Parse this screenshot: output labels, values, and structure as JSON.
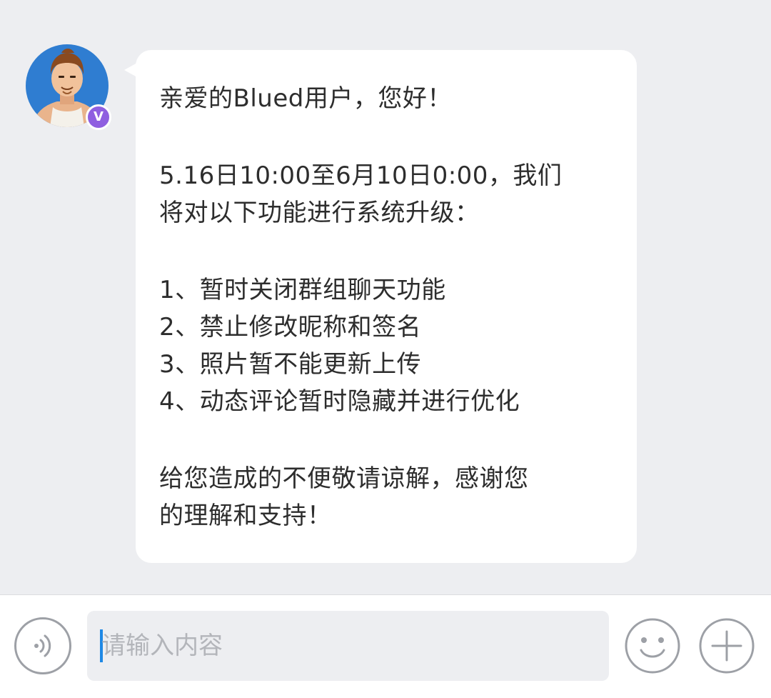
{
  "chat": {
    "sender": {
      "avatar_icon": "user-avatar-icon",
      "verified_badge": "V"
    },
    "message_lines": [
      "亲爱的Blued用户，您好！",
      "5.16日10:00至6月10日0:00，我们",
      "将对以下功能进行系统升级：",
      "1、暂时关闭群组聊天功能",
      "2、禁止修改昵称和签名",
      "3、照片暂不能更新上传",
      "4、动态评论暂时隐藏并进行优化",
      "给您造成的不便敬请谅解，感谢您",
      "的理解和支持！"
    ]
  },
  "input_bar": {
    "voice_icon": "voice-icon",
    "placeholder": "请输入内容",
    "emoji_icon": "smiley-icon",
    "add_icon": "plus-icon"
  },
  "colors": {
    "background": "#edeef1",
    "bubble": "#ffffff",
    "text": "#2d2d2d",
    "icon_gray": "#9da0a6",
    "caret": "#1e88e5",
    "badge": "#8f5fe0",
    "avatar_bg": "#2f7dd1"
  }
}
